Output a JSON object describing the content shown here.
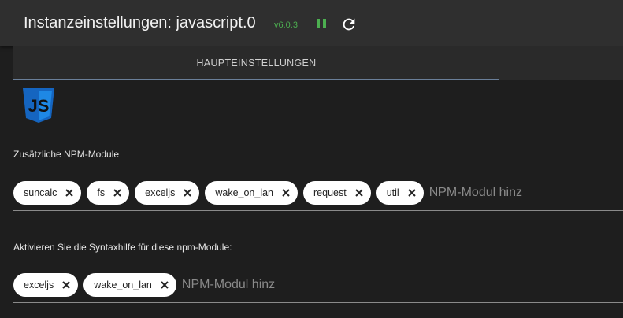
{
  "header": {
    "title": "Instanzeinstellungen: javascript.0",
    "version": "v6.0.3",
    "pause_color": "#4caf50"
  },
  "tabs": [
    {
      "label": "HAUPTEINSTELLUNGEN",
      "active": true
    }
  ],
  "logo": {
    "text": "JS",
    "color": "#1565c0"
  },
  "npm_modules": {
    "label": "Zusätzliche NPM-Module",
    "chips": [
      "suncalc",
      "fs",
      "exceljs",
      "wake_on_lan",
      "request",
      "util"
    ],
    "placeholder": "NPM-Modul hinz"
  },
  "syntax_help": {
    "label": "Aktivieren Sie die Syntaxhilfe für diese npm-Module:",
    "chips": [
      "exceljs",
      "wake_on_lan"
    ],
    "placeholder": "NPM-Modul hinz"
  }
}
